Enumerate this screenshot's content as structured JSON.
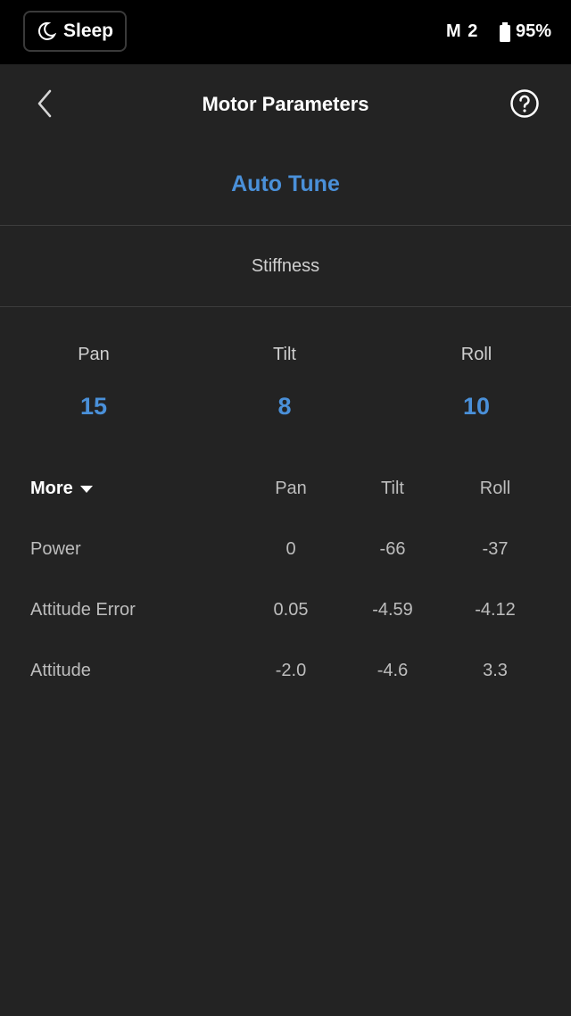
{
  "status_bar": {
    "sleep_label": "Sleep",
    "mode": "M 2",
    "battery": "95%"
  },
  "nav": {
    "title": "Motor Parameters"
  },
  "auto_tune_label": "Auto Tune",
  "stiffness": {
    "label": "Stiffness",
    "axes": [
      {
        "name": "Pan",
        "value": "15"
      },
      {
        "name": "Tilt",
        "value": "8"
      },
      {
        "name": "Roll",
        "value": "10"
      }
    ]
  },
  "table": {
    "more_label": "More",
    "columns": [
      "Pan",
      "Tilt",
      "Roll"
    ],
    "rows": [
      {
        "label": "Power",
        "values": [
          "0",
          "-66",
          "-37"
        ]
      },
      {
        "label": "Attitude Error",
        "values": [
          "0.05",
          "-4.59",
          "-4.12"
        ]
      },
      {
        "label": "Attitude",
        "values": [
          "-2.0",
          "-4.6",
          "3.3"
        ]
      }
    ]
  },
  "colors": {
    "background": "#232323",
    "status_bar": "#000000",
    "accent": "#4a90d9",
    "text": "#cfcfcf"
  },
  "icons": {
    "sleep": "moon-icon",
    "battery": "battery-icon",
    "back": "chevron-left-icon",
    "help": "question-circle-icon",
    "more": "caret-down-icon"
  }
}
